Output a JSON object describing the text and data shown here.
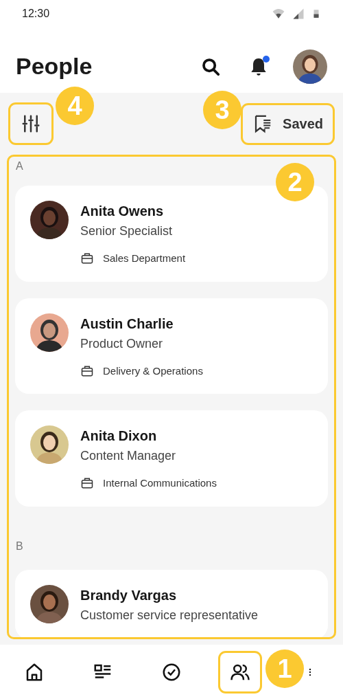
{
  "status_bar": {
    "time": "12:30"
  },
  "header": {
    "title": "People",
    "notification_unread": true
  },
  "toolbar": {
    "filter": {
      "highlighted": true
    },
    "saved": {
      "label": "Saved",
      "highlighted": true
    }
  },
  "list": {
    "highlighted": true,
    "sections": [
      {
        "letter": "A",
        "people": [
          {
            "name": "Anita Owens",
            "role": "Senior Specialist",
            "department": "Sales Department"
          },
          {
            "name": "Austin Charlie",
            "role": "Product Owner",
            "department": "Delivery & Operations"
          },
          {
            "name": "Anita Dixon",
            "role": "Content Manager",
            "department": "Internal Communications"
          }
        ]
      },
      {
        "letter": "B",
        "people": [
          {
            "name": "Brandy Vargas",
            "role": "Customer service representative"
          }
        ]
      }
    ]
  },
  "bottom_nav": [
    {
      "kind": "home",
      "highlighted": false
    },
    {
      "kind": "news",
      "highlighted": false
    },
    {
      "kind": "tasks",
      "highlighted": false
    },
    {
      "kind": "people",
      "highlighted": true
    },
    {
      "kind": "more",
      "highlighted": false
    }
  ],
  "callouts": [
    {
      "number": "1",
      "kind": "nav"
    },
    {
      "number": "2",
      "kind": "list"
    },
    {
      "number": "3",
      "kind": "saved"
    },
    {
      "number": "4",
      "kind": "filter"
    }
  ]
}
